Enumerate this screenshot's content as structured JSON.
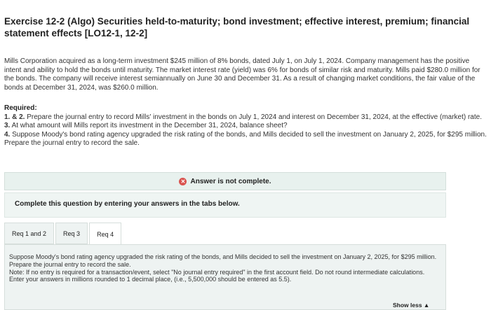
{
  "exercise": {
    "title": "Exercise 12-2 (Algo) Securities held-to-maturity; bond investment; effective interest, premium; financial statement effects [LO12-1, 12-2]",
    "intro": "Mills Corporation acquired as a long-term investment $245 million of 8% bonds, dated July 1, on July 1, 2024. Company management has the positive intent and ability to hold the bonds until maturity. The market interest rate (yield) was 6% for bonds of similar risk and maturity. Mills paid $280.0 million for the bonds. The company will receive interest semiannually on June 30 and December 31. As a result of changing market conditions, the fair value of the bonds at December 31, 2024, was $260.0 million."
  },
  "required": {
    "heading": "Required:",
    "items": [
      {
        "num": "1. & 2.",
        "text": "Prepare the journal entry to record Mills' investment in the bonds on July 1, 2024 and interest on December 31, 2024, at the effective (market) rate."
      },
      {
        "num": "3.",
        "text": "At what amount will Mills report its investment in the December 31, 2024, balance sheet?"
      },
      {
        "num": "4.",
        "text": "Suppose Moody's bond rating agency upgraded the risk rating of the bonds, and Mills decided to sell the investment on January 2, 2025, for $295 million. Prepare the journal entry to record the sale."
      }
    ]
  },
  "answer_status": "Answer is not complete.",
  "complete_prompt": "Complete this question by entering your answers in the tabs below.",
  "tabs": [
    {
      "label": "Req 1 and 2",
      "active": false
    },
    {
      "label": "Req 3",
      "active": false
    },
    {
      "label": "Req 4",
      "active": true
    }
  ],
  "panel": {
    "question": "Suppose Moody's bond rating agency upgraded the risk rating of the bonds, and Mills decided to sell the investment on January 2, 2025, for $295 million. Prepare the journal entry to record the sale.",
    "note": "Note: If no entry is required for a transaction/event, select \"No journal entry required\" in the first account field. Do not round intermediate calculations. Enter your answers in millions rounded to 1 decimal place, (i.e., 5,500,000 should be entered as 5.5)."
  },
  "show_less": "Show less ▲",
  "colors": {
    "error_icon": "#d9534f",
    "banner_bg": "#e8f1ee",
    "panel_bg": "#eef3f2"
  },
  "icons": {
    "status": "x-circle-icon"
  }
}
